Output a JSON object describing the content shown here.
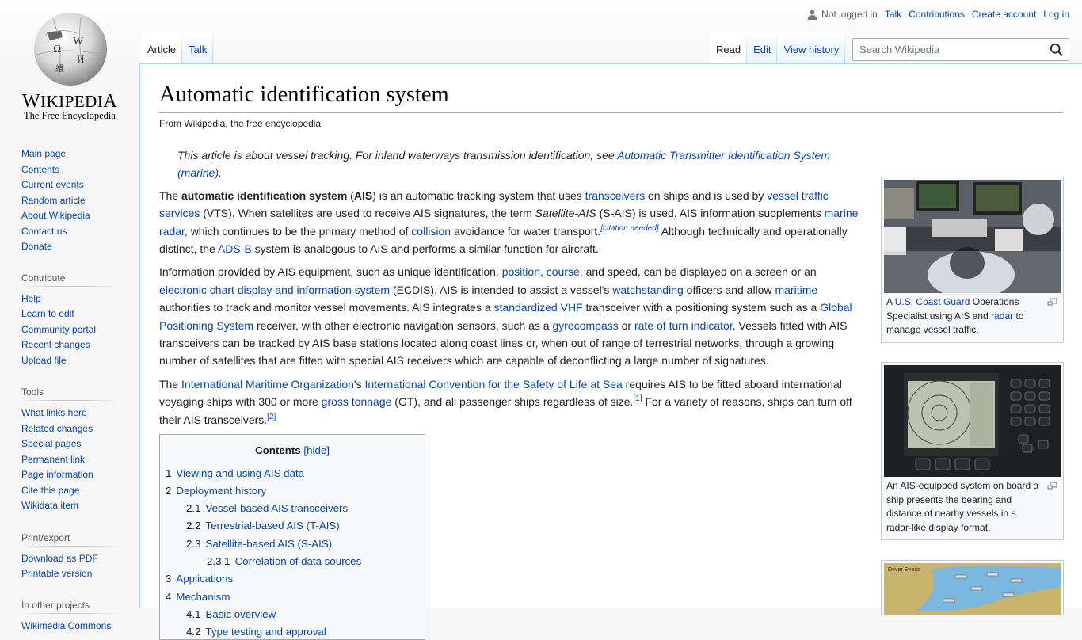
{
  "logo": {
    "wordmark": "Wikipedia",
    "tagline": "The Free Encyclopedia"
  },
  "personal_tools": {
    "status": "Not logged in",
    "links": [
      "Talk",
      "Contributions",
      "Create account",
      "Log in"
    ],
    "icon": "user-icon"
  },
  "tabs": {
    "namespaces": [
      {
        "label": "Article",
        "selected": true
      },
      {
        "label": "Talk",
        "selected": false
      }
    ],
    "views": [
      {
        "label": "Read",
        "selected": true
      },
      {
        "label": "Edit",
        "selected": false
      },
      {
        "label": "View history",
        "selected": false
      }
    ]
  },
  "search": {
    "placeholder": "Search Wikipedia",
    "value": "",
    "icon": "search-icon"
  },
  "sidebar": {
    "navigation": [
      "Main page",
      "Contents",
      "Current events",
      "Random article",
      "About Wikipedia",
      "Contact us",
      "Donate"
    ],
    "contribute": {
      "heading": "Contribute",
      "items": [
        "Help",
        "Learn to edit",
        "Community portal",
        "Recent changes",
        "Upload file"
      ]
    },
    "tools": {
      "heading": "Tools",
      "items": [
        "What links here",
        "Related changes",
        "Special pages",
        "Permanent link",
        "Page information",
        "Cite this page",
        "Wikidata item"
      ]
    },
    "print": {
      "heading": "Print/export",
      "items": [
        "Download as PDF",
        "Printable version"
      ]
    },
    "projects": {
      "heading": "In other projects",
      "items": [
        "Wikimedia Commons"
      ]
    }
  },
  "article": {
    "title": "Automatic identification system",
    "from": "From Wikipedia, the free encyclopedia",
    "hatnote": {
      "text": "This article is about vessel tracking. For inland waterways transmission identification, see ",
      "link": "Automatic Transmitter Identification System (marine)",
      "end": "."
    },
    "p1": {
      "t0": "The ",
      "b1": "automatic identification system",
      "t1": " (",
      "b2": "AIS",
      "t2": ") is an automatic tracking system that uses ",
      "l1": "transceivers",
      "t3": " on ships and is used by ",
      "l2": "vessel traffic services",
      "t4": " (VTS). When satellites are used to receive AIS signatures, the term ",
      "i1": "Satellite-AIS",
      "t5": " (S-AIS) is used. AIS information supplements ",
      "l3": "marine radar",
      "t6": ", which continues to be the primary method of ",
      "l4": "collision",
      "t7": " avoidance for water transport.",
      "cn": "[citation needed]",
      "t8": " Although technically and operationally distinct, the ",
      "l5": "ADS-B",
      "t9": " system is analogous to AIS and performs a similar function for aircraft."
    },
    "p2": {
      "t0": "Information provided by AIS equipment, such as unique identification, ",
      "l1": "position",
      "t1": ", ",
      "l2": "course",
      "t2": ", and speed, can be displayed on a screen or an ",
      "l3": "electronic chart display and information system",
      "t3": " (ECDIS). AIS is intended to assist a vessel's ",
      "l4": "watchstanding",
      "t4": " officers and allow ",
      "l5": "maritime",
      "t5": " authorities to track and monitor vessel movements. AIS integrates a ",
      "l6": "standardized VHF",
      "t6": " transceiver with a positioning system such as a ",
      "l7": "Global Positioning System",
      "t7": " receiver, with other electronic navigation sensors, such as a ",
      "l8": "gyrocompass",
      "t8": " or ",
      "l9": "rate of turn indicator",
      "t9": ". Vessels fitted with AIS transceivers can be tracked by AIS base stations located along coast lines or, when out of range of terrestrial networks, through a growing number of satellites that are fitted with special AIS receivers which are capable of deconflicting a large number of signatures."
    },
    "p3": {
      "t0": "The ",
      "l1": "International Maritime Organization",
      "t1": "'s ",
      "l2": "International Convention for the Safety of Life at Sea",
      "t2": " requires AIS to be fitted aboard international voyaging ships with 300 or more ",
      "l3": "gross tonnage",
      "t3": " (GT), and all passenger ships regardless of size.",
      "r1": "[1]",
      "t4": " For a variety of reasons, ships can turn off their AIS transceivers.",
      "r2": "[2]"
    }
  },
  "toc": {
    "title": "Contents",
    "toggle": "[hide]",
    "items": [
      {
        "num": "1",
        "label": "Viewing and using AIS data",
        "level": 1
      },
      {
        "num": "2",
        "label": "Deployment history",
        "level": 1
      },
      {
        "num": "2.1",
        "label": "Vessel-based AIS transceivers",
        "level": 2
      },
      {
        "num": "2.2",
        "label": "Terrestrial-based AIS (T-AIS)",
        "level": 2
      },
      {
        "num": "2.3",
        "label": "Satellite-based AIS (S-AIS)",
        "level": 2
      },
      {
        "num": "2.3.1",
        "label": "Correlation of data sources",
        "level": 3
      },
      {
        "num": "3",
        "label": "Applications",
        "level": 1
      },
      {
        "num": "4",
        "label": "Mechanism",
        "level": 1
      },
      {
        "num": "4.1",
        "label": "Basic overview",
        "level": 2
      },
      {
        "num": "4.2",
        "label": "Type testing and approval",
        "level": 2
      }
    ]
  },
  "thumbnails": [
    {
      "image": "coast-guard-operations-photo",
      "caption": {
        "t0": "A ",
        "l1": "U.S. Coast Guard",
        "t1": " Operations Specialist using AIS and ",
        "l2": "radar",
        "t2": " to manage vessel traffic."
      }
    },
    {
      "image": "ais-radar-display-photo",
      "caption": {
        "t0": "An AIS-equipped system on board a ship presents the bearing and distance of nearby vessels in a radar-like display format."
      }
    },
    {
      "image": "dover-straits-ais-map",
      "map_label": "Dover Straits"
    }
  ],
  "colors": {
    "link": "#0645ad",
    "text": "#202122",
    "border": "#a7d7f9",
    "sidebar_bg": "#f6f6f6"
  }
}
